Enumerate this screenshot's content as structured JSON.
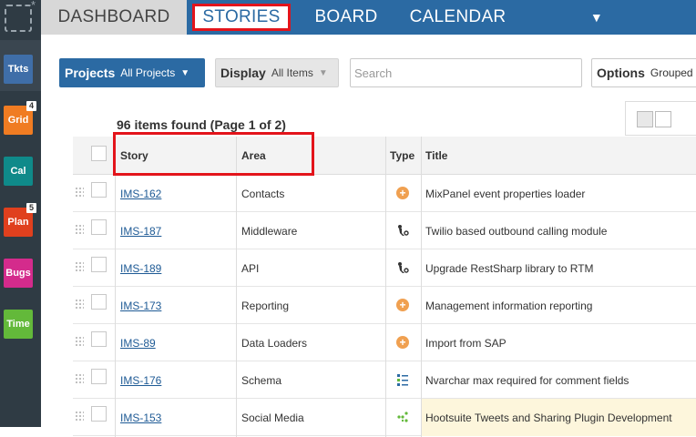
{
  "rail": {
    "items": [
      {
        "label": "Tkts",
        "color": "#3f6ea8",
        "badge": ""
      },
      {
        "label": "Grid",
        "color": "#f07c22",
        "badge": "4"
      },
      {
        "label": "Cal",
        "color": "#0f8a8a",
        "badge": ""
      },
      {
        "label": "Plan",
        "color": "#e0401e",
        "badge": "5"
      },
      {
        "label": "Bugs",
        "color": "#d42b8c",
        "badge": ""
      },
      {
        "label": "Time",
        "color": "#63b93a",
        "badge": ""
      }
    ]
  },
  "nav": {
    "tabs": [
      "DASHBOARD",
      "STORIES",
      "BOARD",
      "CALENDAR"
    ],
    "more_icon": "caret-down-icon",
    "active": "STORIES"
  },
  "filters": {
    "projects_label": "Projects",
    "projects_value": "All Projects",
    "display_label": "Display",
    "display_value": "All Items",
    "search_placeholder": "Search",
    "options_label": "Options",
    "options_value": "Grouped"
  },
  "result_count": "96 items found (Page 1 of 2)",
  "table": {
    "headers": {
      "story": "Story",
      "area": "Area",
      "type": "Type",
      "title": "Title"
    },
    "rows": [
      {
        "story": "IMS-162",
        "area": "Contacts",
        "type": "feature-icon",
        "title": "MixPanel event properties loader"
      },
      {
        "story": "IMS-187",
        "area": "Middleware",
        "type": "bug-icon",
        "title": "Twilio based outbound calling module"
      },
      {
        "story": "IMS-189",
        "area": "API",
        "type": "bug-icon",
        "title": "Upgrade RestSharp library to RTM"
      },
      {
        "story": "IMS-173",
        "area": "Reporting",
        "type": "feature-icon",
        "title": "Management information reporting"
      },
      {
        "story": "IMS-89",
        "area": "Data Loaders",
        "type": "feature-icon",
        "title": "Import from SAP"
      },
      {
        "story": "IMS-176",
        "area": "Schema",
        "type": "task-list-icon",
        "title": "Nvarchar max required for comment fields"
      },
      {
        "story": "IMS-153",
        "area": "Social Media",
        "type": "share-icon",
        "title": "Hootsuite Tweets and Sharing Plugin Development"
      }
    ]
  },
  "colors": {
    "accent": "#2b6aa3",
    "highlight": "#e3141b"
  }
}
